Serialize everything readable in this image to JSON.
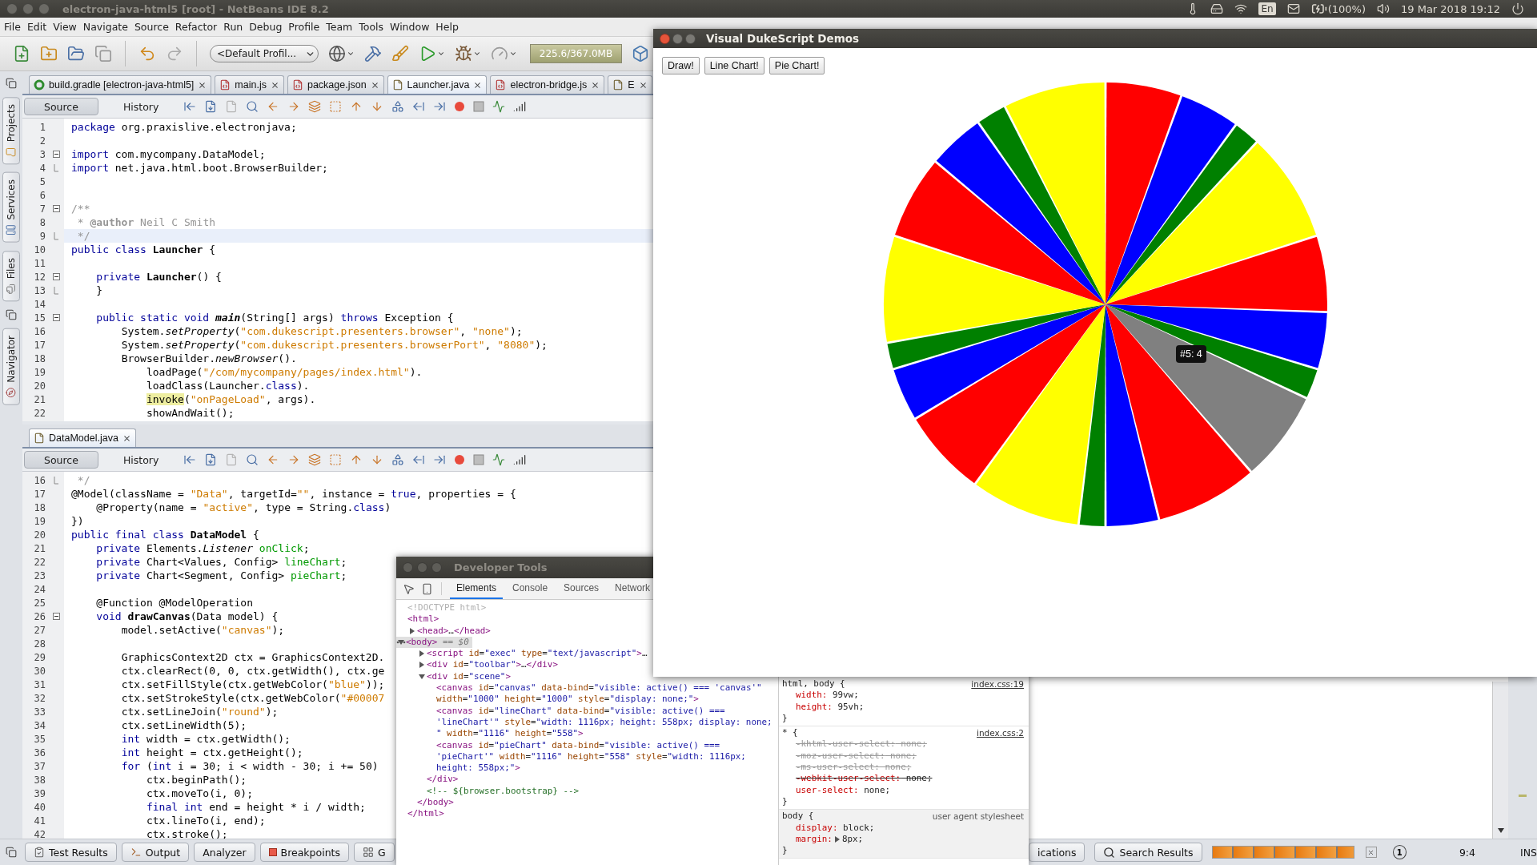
{
  "top_panel": {
    "title": "electron-java-html5 [root] - NetBeans IDE 8.2",
    "keyboard": "En",
    "battery": "(100%)",
    "clock": "19 Mar 2018 19:12"
  },
  "menu": [
    "File",
    "Edit",
    "View",
    "Navigate",
    "Source",
    "Refactor",
    "Run",
    "Debug",
    "Profile",
    "Team",
    "Tools",
    "Window",
    "Help"
  ],
  "toolbar": {
    "profile": "<Default Profil...",
    "memory": "225.6/367.0MB"
  },
  "side_tabs": [
    "Projects",
    "Services",
    "Files",
    "Navigator"
  ],
  "editors": [
    {
      "tabs": [
        {
          "label": "build.gradle [electron-java-html5]",
          "kind": "gradle",
          "selected": false
        },
        {
          "label": "main.js",
          "kind": "js",
          "selected": false
        },
        {
          "label": "package.json",
          "kind": "js",
          "selected": false
        },
        {
          "label": "Launcher.java",
          "kind": "java",
          "selected": true
        },
        {
          "label": "electron-bridge.js",
          "kind": "js",
          "selected": false
        },
        {
          "label": "E",
          "kind": "java",
          "selected": false
        }
      ],
      "views": [
        {
          "label": "Source",
          "selected": true
        },
        {
          "label": "History",
          "selected": false
        }
      ],
      "lines": [
        {
          "number": "1",
          "kind": "plain",
          "current": false,
          "parts": [
            {
              "kind": "keyword",
              "text": "package"
            },
            {
              "kind": "plain",
              "text": " org.praxislive.electronjava;"
            }
          ]
        },
        {
          "number": "2",
          "kind": "plain",
          "current": false
        },
        {
          "number": "3",
          "kind": "foldstart",
          "current": false,
          "parts": [
            {
              "kind": "keyword",
              "text": "import"
            },
            {
              "kind": "plain",
              "text": " com.mycompany.DataModel;"
            }
          ]
        },
        {
          "number": "4",
          "kind": "foldend",
          "current": false,
          "parts": [
            {
              "kind": "keyword",
              "text": "import"
            },
            {
              "kind": "plain",
              "text": " net.java.html.boot.BrowserBuilder;"
            }
          ]
        },
        {
          "number": "5",
          "kind": "plain",
          "current": false
        },
        {
          "number": "6",
          "kind": "plain",
          "current": false
        },
        {
          "number": "7",
          "kind": "foldstart",
          "current": false,
          "parts": [
            {
              "kind": "comment",
              "text": "/**"
            }
          ]
        },
        {
          "number": "8",
          "kind": "plain",
          "current": false,
          "parts": [
            {
              "kind": "comment",
              "text": " * "
            },
            {
              "kind": "comment-tag",
              "text": "@author"
            },
            {
              "kind": "comment",
              "text": " Neil C Smith"
            }
          ]
        },
        {
          "number": "9",
          "kind": "foldend",
          "current": true,
          "parts": [
            {
              "kind": "comment",
              "text": " */"
            }
          ]
        },
        {
          "number": "10",
          "kind": "plain",
          "current": false,
          "parts": [
            {
              "kind": "keyword",
              "text": "public class "
            },
            {
              "kind": "bold",
              "text": "Launcher"
            },
            {
              "kind": "plain",
              "text": " {"
            }
          ]
        },
        {
          "number": "11",
          "kind": "plain",
          "current": false
        },
        {
          "number": "12",
          "kind": "foldstart",
          "current": false,
          "parts": [
            {
              "kind": "keyword",
              "text": "    private "
            },
            {
              "kind": "bold",
              "text": "Launcher"
            },
            {
              "kind": "plain",
              "text": "() {"
            }
          ]
        },
        {
          "number": "13",
          "kind": "foldend",
          "current": false,
          "parts": [
            {
              "kind": "plain",
              "text": "    }"
            }
          ]
        },
        {
          "number": "14",
          "kind": "plain",
          "current": false
        },
        {
          "number": "15",
          "kind": "foldstart",
          "current": false,
          "parts": [
            {
              "kind": "keyword",
              "text": "    public static void "
            },
            {
              "kind": "bold-italic",
              "text": "main"
            },
            {
              "kind": "plain",
              "text": "(String[] args) "
            },
            {
              "kind": "keyword",
              "text": "throws"
            },
            {
              "kind": "plain",
              "text": " Exception {"
            }
          ]
        },
        {
          "number": "16",
          "kind": "plain",
          "current": false,
          "parts": [
            {
              "kind": "plain",
              "text": "        System."
            },
            {
              "kind": "italic",
              "text": "setProperty"
            },
            {
              "kind": "plain",
              "text": "("
            },
            {
              "kind": "string",
              "text": "\"com.dukescript.presenters.browser\""
            },
            {
              "kind": "plain",
              "text": ", "
            },
            {
              "kind": "string",
              "text": "\"none\""
            },
            {
              "kind": "plain",
              "text": ");"
            }
          ]
        },
        {
          "number": "17",
          "kind": "plain",
          "current": false,
          "parts": [
            {
              "kind": "plain",
              "text": "        System."
            },
            {
              "kind": "italic",
              "text": "setProperty"
            },
            {
              "kind": "plain",
              "text": "("
            },
            {
              "kind": "string",
              "text": "\"com.dukescript.presenters.browserPort\""
            },
            {
              "kind": "plain",
              "text": ", "
            },
            {
              "kind": "string",
              "text": "\"8080\""
            },
            {
              "kind": "plain",
              "text": ");"
            }
          ]
        },
        {
          "number": "18",
          "kind": "plain",
          "current": false,
          "parts": [
            {
              "kind": "plain",
              "text": "        BrowserBuilder."
            },
            {
              "kind": "italic",
              "text": "newBrowser"
            },
            {
              "kind": "plain",
              "text": "()."
            }
          ]
        },
        {
          "number": "19",
          "kind": "plain",
          "current": false,
          "parts": [
            {
              "kind": "plain",
              "text": "            loadPage("
            },
            {
              "kind": "string",
              "text": "\"/com/mycompany/pages/index.html\""
            },
            {
              "kind": "plain",
              "text": ")."
            }
          ]
        },
        {
          "number": "20",
          "kind": "plain",
          "current": false,
          "parts": [
            {
              "kind": "plain",
              "text": "            loadClass(Launcher."
            },
            {
              "kind": "keyword",
              "text": "class"
            },
            {
              "kind": "plain",
              "text": ")."
            }
          ]
        },
        {
          "number": "21",
          "kind": "plain",
          "current": false,
          "parts": [
            {
              "kind": "highlight",
              "text": "            invoke"
            },
            {
              "kind": "plain",
              "text": "("
            },
            {
              "kind": "string",
              "text": "\"onPageLoad\""
            },
            {
              "kind": "plain",
              "text": ", args)."
            }
          ]
        },
        {
          "number": "22",
          "kind": "plain",
          "current": false,
          "parts": [
            {
              "kind": "plain",
              "text": "            showAndWait();"
            }
          ]
        }
      ]
    },
    {
      "tabs": [
        {
          "label": "DataModel.java",
          "kind": "java",
          "selected": true
        }
      ],
      "views": [
        {
          "label": "Source",
          "selected": true
        },
        {
          "label": "History",
          "selected": false
        }
      ],
      "lines": [
        {
          "number": "16",
          "kind": "foldend",
          "current": false,
          "parts": [
            {
              "kind": "comment",
              "text": " */"
            }
          ]
        },
        {
          "number": "17",
          "kind": "plain",
          "current": false,
          "parts": [
            {
              "kind": "plain",
              "text": "@Model(className = "
            },
            {
              "kind": "string",
              "text": "\"Data\""
            },
            {
              "kind": "plain",
              "text": ", targetId="
            },
            {
              "kind": "string",
              "text": "\"\""
            },
            {
              "kind": "plain",
              "text": ", instance = "
            },
            {
              "kind": "keyword",
              "text": "true"
            },
            {
              "kind": "plain",
              "text": ", properties = {"
            }
          ]
        },
        {
          "number": "18",
          "kind": "plain",
          "current": false,
          "parts": [
            {
              "kind": "plain",
              "text": "    @Property(name = "
            },
            {
              "kind": "string",
              "text": "\"active\""
            },
            {
              "kind": "plain",
              "text": ", type = String."
            },
            {
              "kind": "keyword",
              "text": "class"
            },
            {
              "kind": "plain",
              "text": ")"
            }
          ]
        },
        {
          "number": "19",
          "kind": "plain",
          "current": false,
          "parts": [
            {
              "kind": "plain",
              "text": "})"
            }
          ]
        },
        {
          "number": "20",
          "kind": "plain",
          "current": false,
          "parts": [
            {
              "kind": "keyword",
              "text": "public final class "
            },
            {
              "kind": "bold",
              "text": "DataModel"
            },
            {
              "kind": "plain",
              "text": " {"
            }
          ]
        },
        {
          "number": "21",
          "kind": "plain",
          "current": false,
          "parts": [
            {
              "kind": "keyword",
              "text": "    private"
            },
            {
              "kind": "plain",
              "text": " Elements."
            },
            {
              "kind": "italic",
              "text": "Listener"
            },
            {
              "kind": "field",
              "text": " onClick"
            },
            {
              "kind": "plain",
              "text": ";"
            }
          ]
        },
        {
          "number": "22",
          "kind": "plain",
          "current": false,
          "parts": [
            {
              "kind": "keyword",
              "text": "    private"
            },
            {
              "kind": "plain",
              "text": " Chart<Values, Config> "
            },
            {
              "kind": "field",
              "text": "lineChart"
            },
            {
              "kind": "plain",
              "text": ";"
            }
          ]
        },
        {
          "number": "23",
          "kind": "plain",
          "current": false,
          "parts": [
            {
              "kind": "keyword",
              "text": "    private"
            },
            {
              "kind": "plain",
              "text": " Chart<Segment, Config> "
            },
            {
              "kind": "field",
              "text": "pieChart"
            },
            {
              "kind": "plain",
              "text": ";"
            }
          ]
        },
        {
          "number": "24",
          "kind": "plain",
          "current": false
        },
        {
          "number": "25",
          "kind": "plain",
          "current": false,
          "parts": [
            {
              "kind": "plain",
              "text": "    @Function @ModelOperation"
            }
          ]
        },
        {
          "number": "26",
          "kind": "foldstart",
          "current": false,
          "parts": [
            {
              "kind": "keyword",
              "text": "    void "
            },
            {
              "kind": "bold",
              "text": "drawCanvas"
            },
            {
              "kind": "plain",
              "text": "(Data model) {"
            }
          ]
        },
        {
          "number": "27",
          "kind": "plain",
          "current": false,
          "parts": [
            {
              "kind": "plain",
              "text": "        model.setActive("
            },
            {
              "kind": "string",
              "text": "\"canvas\""
            },
            {
              "kind": "plain",
              "text": ");"
            }
          ]
        },
        {
          "number": "28",
          "kind": "plain",
          "current": false
        },
        {
          "number": "29",
          "kind": "plain",
          "current": false,
          "parts": [
            {
              "kind": "plain",
              "text": "        GraphicsContext2D ctx = GraphicsContext2D."
            }
          ]
        },
        {
          "number": "30",
          "kind": "plain",
          "current": false,
          "parts": [
            {
              "kind": "plain",
              "text": "        ctx.clearRect(0, 0, ctx.getWidth(), ctx.ge"
            }
          ]
        },
        {
          "number": "31",
          "kind": "plain",
          "current": false,
          "parts": [
            {
              "kind": "plain",
              "text": "        ctx.setFillStyle(ctx.getWebColor("
            },
            {
              "kind": "string",
              "text": "\"blue\""
            },
            {
              "kind": "plain",
              "text": "));"
            }
          ]
        },
        {
          "number": "32",
          "kind": "plain",
          "current": false,
          "parts": [
            {
              "kind": "plain",
              "text": "        ctx.setStrokeStyle(ctx.getWebColor("
            },
            {
              "kind": "string",
              "text": "\"#00007"
            }
          ]
        },
        {
          "number": "33",
          "kind": "plain",
          "current": false,
          "parts": [
            {
              "kind": "plain",
              "text": "        ctx.setLineJoin("
            },
            {
              "kind": "string",
              "text": "\"round\""
            },
            {
              "kind": "plain",
              "text": ");"
            }
          ]
        },
        {
          "number": "34",
          "kind": "plain",
          "current": false,
          "parts": [
            {
              "kind": "plain",
              "text": "        ctx.setLineWidth(5);"
            }
          ]
        },
        {
          "number": "35",
          "kind": "plain",
          "current": false,
          "parts": [
            {
              "kind": "keyword",
              "text": "        int"
            },
            {
              "kind": "plain",
              "text": " width = ctx.getWidth();"
            }
          ]
        },
        {
          "number": "36",
          "kind": "plain",
          "current": false,
          "parts": [
            {
              "kind": "keyword",
              "text": "        int"
            },
            {
              "kind": "plain",
              "text": " height = ctx.getHeight();"
            }
          ]
        },
        {
          "number": "37",
          "kind": "plain",
          "current": false,
          "parts": [
            {
              "kind": "keyword",
              "text": "        for"
            },
            {
              "kind": "plain",
              "text": " ("
            },
            {
              "kind": "keyword",
              "text": "int"
            },
            {
              "kind": "plain",
              "text": " i = 30; i < width - 30; i += 50)"
            }
          ]
        },
        {
          "number": "38",
          "kind": "plain",
          "current": false,
          "parts": [
            {
              "kind": "plain",
              "text": "            ctx.beginPath();"
            }
          ]
        },
        {
          "number": "39",
          "kind": "plain",
          "current": false,
          "parts": [
            {
              "kind": "plain",
              "text": "            ctx.moveTo(i, 0);"
            }
          ]
        },
        {
          "number": "40",
          "kind": "plain",
          "current": false,
          "parts": [
            {
              "kind": "keyword",
              "text": "            final int"
            },
            {
              "kind": "plain",
              "text": " end = height * i / width;"
            }
          ]
        },
        {
          "number": "41",
          "kind": "plain",
          "current": false,
          "parts": [
            {
              "kind": "plain",
              "text": "            ctx.lineTo(i, end);"
            }
          ]
        },
        {
          "number": "42",
          "kind": "plain",
          "current": false,
          "parts": [
            {
              "kind": "plain",
              "text": "            ctx.stroke();"
            }
          ]
        }
      ]
    }
  ],
  "devtools": {
    "title": "Developer Tools",
    "tabs": [
      {
        "label": "Elements",
        "selected": true
      },
      {
        "label": "Console",
        "selected": false
      },
      {
        "label": "Sources",
        "selected": false
      },
      {
        "label": "Network",
        "selected": false
      }
    ],
    "dom": [
      {
        "expandable": false,
        "selected": false,
        "lines": [
          [
            {
              "kind": "doctype",
              "text": "<!DOCTYPE html>"
            }
          ]
        ]
      },
      {
        "expandable": false,
        "selected": false,
        "lines": [
          [
            {
              "kind": "tag",
              "text": "<html>"
            }
          ]
        ],
        "closing": [
          {
            "kind": "tag",
            "text": "</html>"
          }
        ],
        "children": [
          {
            "expandable": true,
            "expanded": false,
            "selected": false,
            "lines": [
              [
                {
                  "kind": "tag",
                  "text": "<head>"
                },
                {
                  "kind": "plain",
                  "text": "…"
                },
                {
                  "kind": "tag",
                  "text": "</head>"
                }
              ]
            ]
          },
          {
            "expandable": true,
            "expanded": true,
            "selected": true,
            "lines": [
              [
                {
                  "kind": "tag",
                  "text": "<body>"
                },
                {
                  "kind": "hint",
                  "text": " == $0"
                }
              ]
            ],
            "closing": [
              {
                "kind": "tag",
                "text": "</body>"
              }
            ],
            "children": [
              {
                "expandable": true,
                "expanded": false,
                "selected": false,
                "lines": [
                  [
                    {
                      "kind": "tag",
                      "text": "<script"
                    },
                    {
                      "kind": "attr",
                      "text": " id"
                    },
                    {
                      "kind": "plain",
                      "text": "="
                    },
                    {
                      "kind": "value",
                      "text": "\"exec\""
                    },
                    {
                      "kind": "attr",
                      "text": " type"
                    },
                    {
                      "kind": "plain",
                      "text": "="
                    },
                    {
                      "kind": "value",
                      "text": "\"text/javascript\""
                    },
                    {
                      "kind": "tag",
                      "text": ">"
                    },
                    {
                      "kind": "plain",
                      "text": "…"
                    }
                  ]
                ]
              },
              {
                "expandable": true,
                "expanded": false,
                "selected": false,
                "lines": [
                  [
                    {
                      "kind": "tag",
                      "text": "<div"
                    },
                    {
                      "kind": "attr",
                      "text": " id"
                    },
                    {
                      "kind": "plain",
                      "text": "="
                    },
                    {
                      "kind": "value",
                      "text": "\"toolbar\""
                    },
                    {
                      "kind": "tag",
                      "text": ">"
                    },
                    {
                      "kind": "plain",
                      "text": "…"
                    },
                    {
                      "kind": "tag",
                      "text": "</div>"
                    }
                  ]
                ]
              },
              {
                "expandable": true,
                "expanded": true,
                "selected": false,
                "lines": [
                  [
                    {
                      "kind": "tag",
                      "text": "<div"
                    },
                    {
                      "kind": "attr",
                      "text": " id"
                    },
                    {
                      "kind": "plain",
                      "text": "="
                    },
                    {
                      "kind": "value",
                      "text": "\"scene\""
                    },
                    {
                      "kind": "tag",
                      "text": ">"
                    }
                  ]
                ],
                "closing": [
                  {
                    "kind": "tag",
                    "text": "</div>"
                  }
                ],
                "children": [
                  {
                    "expandable": false,
                    "selected": false,
                    "lines": [
                      [
                        {
                          "kind": "tag",
                          "text": "<canvas"
                        },
                        {
                          "kind": "attr",
                          "text": " id"
                        },
                        {
                          "kind": "plain",
                          "text": "="
                        },
                        {
                          "kind": "value",
                          "text": "\"canvas\""
                        },
                        {
                          "kind": "attr",
                          "text": " data-bind"
                        },
                        {
                          "kind": "plain",
                          "text": "="
                        },
                        {
                          "kind": "value",
                          "text": "\"visible: active() === 'canvas'\""
                        }
                      ],
                      [
                        {
                          "kind": "attr",
                          "text": "width"
                        },
                        {
                          "kind": "plain",
                          "text": "="
                        },
                        {
                          "kind": "value",
                          "text": "\"1000\""
                        },
                        {
                          "kind": "attr",
                          "text": " height"
                        },
                        {
                          "kind": "plain",
                          "text": "="
                        },
                        {
                          "kind": "value",
                          "text": "\"1000\""
                        },
                        {
                          "kind": "attr",
                          "text": " style"
                        },
                        {
                          "kind": "plain",
                          "text": "="
                        },
                        {
                          "kind": "value",
                          "text": "\"display: none;\""
                        },
                        {
                          "kind": "tag",
                          "text": ">"
                        }
                      ]
                    ]
                  },
                  {
                    "expandable": false,
                    "selected": false,
                    "lines": [
                      [
                        {
                          "kind": "tag",
                          "text": "<canvas"
                        },
                        {
                          "kind": "attr",
                          "text": " id"
                        },
                        {
                          "kind": "plain",
                          "text": "="
                        },
                        {
                          "kind": "value",
                          "text": "\"lineChart\""
                        },
                        {
                          "kind": "attr",
                          "text": " data-bind"
                        },
                        {
                          "kind": "plain",
                          "text": "="
                        },
                        {
                          "kind": "value",
                          "text": "\"visible: active() ==="
                        }
                      ],
                      [
                        {
                          "kind": "value",
                          "text": "'lineChart'\""
                        },
                        {
                          "kind": "attr",
                          "text": " style"
                        },
                        {
                          "kind": "plain",
                          "text": "="
                        },
                        {
                          "kind": "value",
                          "text": "\"width: 1116px; height: 558px; display: none;"
                        }
                      ],
                      [
                        {
                          "kind": "value",
                          "text": "\""
                        },
                        {
                          "kind": "attr",
                          "text": " width"
                        },
                        {
                          "kind": "plain",
                          "text": "="
                        },
                        {
                          "kind": "value",
                          "text": "\"1116\""
                        },
                        {
                          "kind": "attr",
                          "text": " height"
                        },
                        {
                          "kind": "plain",
                          "text": "="
                        },
                        {
                          "kind": "value",
                          "text": "\"558\""
                        },
                        {
                          "kind": "tag",
                          "text": ">"
                        }
                      ]
                    ]
                  },
                  {
                    "expandable": false,
                    "selected": false,
                    "lines": [
                      [
                        {
                          "kind": "tag",
                          "text": "<canvas"
                        },
                        {
                          "kind": "attr",
                          "text": " id"
                        },
                        {
                          "kind": "plain",
                          "text": "="
                        },
                        {
                          "kind": "value",
                          "text": "\"pieChart\""
                        },
                        {
                          "kind": "attr",
                          "text": " data-bind"
                        },
                        {
                          "kind": "plain",
                          "text": "="
                        },
                        {
                          "kind": "value",
                          "text": "\"visible: active() ==="
                        }
                      ],
                      [
                        {
                          "kind": "value",
                          "text": "'pieChart'\""
                        },
                        {
                          "kind": "attr",
                          "text": " width"
                        },
                        {
                          "kind": "plain",
                          "text": "="
                        },
                        {
                          "kind": "value",
                          "text": "\"1116\""
                        },
                        {
                          "kind": "attr",
                          "text": " height"
                        },
                        {
                          "kind": "plain",
                          "text": "="
                        },
                        {
                          "kind": "value",
                          "text": "\"558\""
                        },
                        {
                          "kind": "attr",
                          "text": " style"
                        },
                        {
                          "kind": "plain",
                          "text": "="
                        },
                        {
                          "kind": "value",
                          "text": "\"width: 1116px;"
                        }
                      ],
                      [
                        {
                          "kind": "value",
                          "text": "height: 558px;\""
                        },
                        {
                          "kind": "tag",
                          "text": ">"
                        }
                      ]
                    ]
                  }
                ]
              },
              {
                "expandable": false,
                "selected": false,
                "lines": [
                  [
                    {
                      "kind": "comment",
                      "text": "<!-- ${browser.bootstrap} -->"
                    }
                  ]
                ]
              }
            ]
          }
        ]
      }
    ],
    "styles": [
      {
        "kind": "author",
        "selector": "html, body {",
        "source": "index.css:19",
        "close": "}",
        "declarations": [
          {
            "name": "width:",
            "value": " 99vw;",
            "kind": "active",
            "expandable": false
          },
          {
            "name": "height:",
            "value": " 95vh;",
            "kind": "active",
            "expandable": false
          }
        ]
      },
      {
        "kind": "author",
        "selector": "* {",
        "source": "index.css:2",
        "close": "}",
        "declarations": [
          {
            "name": "-khtml-user-select:",
            "value": " none;",
            "kind": "invalid",
            "expandable": false
          },
          {
            "name": "-moz-user-select:",
            "value": " none;",
            "kind": "invalid",
            "expandable": false
          },
          {
            "name": "-ms-user-select:",
            "value": " none;",
            "kind": "invalid",
            "expandable": false
          },
          {
            "name": "-webkit-user-select:",
            "value": " none;",
            "kind": "overridden",
            "expandable": false
          },
          {
            "name": "user-select:",
            "value": " none;",
            "kind": "active",
            "expandable": false
          }
        ]
      },
      {
        "kind": "useragent",
        "selector": "body {",
        "source": "user agent stylesheet",
        "close": "}",
        "declarations": [
          {
            "name": "display:",
            "value": " block;",
            "kind": "active",
            "expandable": false
          },
          {
            "name": "margin:",
            "value": "8px;",
            "kind": "active",
            "expandable": true
          }
        ]
      }
    ]
  },
  "demo_window": {
    "title": "Visual DukeScript Demos",
    "buttons": [
      "Draw!",
      "Line Chart!",
      "Pie Chart!"
    ],
    "tooltip": "#5: 4"
  },
  "status_bar": {
    "left_tabs": [
      "Test Results",
      "Output",
      "Analyzer",
      "Breakpoints",
      "G"
    ],
    "right_tabs": [
      "ications",
      "Search Results"
    ],
    "progress": {
      "level": 1
    },
    "notifications": "1",
    "position": "9:4",
    "mode": "INS"
  }
}
